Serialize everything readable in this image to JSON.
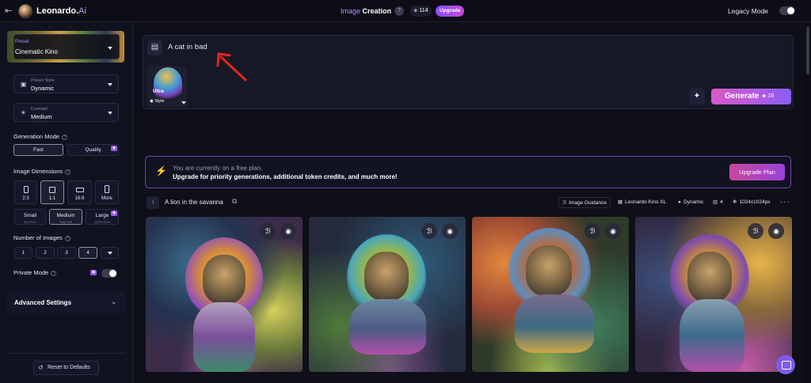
{
  "topbar": {
    "logo_main": "Leonardo.",
    "logo_ai": "Ai",
    "title_word1": "Image",
    "title_word2": "Creation",
    "token_count": "114",
    "upgrade_label": "Upgrade",
    "legacy_mode_label": "Legacy Mode"
  },
  "sidebar": {
    "preset_label": "Preset",
    "preset_value": "Cinematic Kino",
    "preset_style_label": "Preset Style",
    "preset_style_value": "Dynamic",
    "contrast_label": "Contrast",
    "contrast_value": "Medium",
    "generation_mode_label": "Generation Mode",
    "generation_modes": [
      "Fast",
      "Quality"
    ],
    "image_dimensions_label": "Image Dimensions",
    "aspect_ratios": [
      "2:3",
      "1:1",
      "16:9",
      "More"
    ],
    "sizes": [
      {
        "name": "Small",
        "res": "512×512"
      },
      {
        "name": "Medium",
        "res": "768×768"
      },
      {
        "name": "Large",
        "res": "1024×1024"
      }
    ],
    "number_of_images_label": "Number of Images",
    "image_counts": [
      "1",
      "2",
      "3",
      "4"
    ],
    "private_mode_label": "Private Mode",
    "advanced_settings_label": "Advanced Settings",
    "reset_label": "Reset to Defaults"
  },
  "prompt": {
    "text": "A cat in bad",
    "style_thumb_word": "Ultra",
    "style_label": "Style",
    "generate_label": "Generate",
    "generate_cost": "16"
  },
  "banner": {
    "line1": "You are currently on a free plan.",
    "line2": "Upgrade for priority generations, additional token credits, and much more!",
    "button": "Upgrade Plan"
  },
  "generation": {
    "prompt_title": "A lion in the savanna",
    "image_guidance": "Image Guidance",
    "model": "Leonardo Kino XL",
    "style": "Dynamic",
    "count": "4",
    "resolution": "1024x1024px"
  },
  "colors": {
    "accent_purple": "#9d57ff",
    "generate_gradient_start": "#d85ac7",
    "banner_border": "#7b3fb8",
    "annotation_arrow": "#e0261f"
  }
}
